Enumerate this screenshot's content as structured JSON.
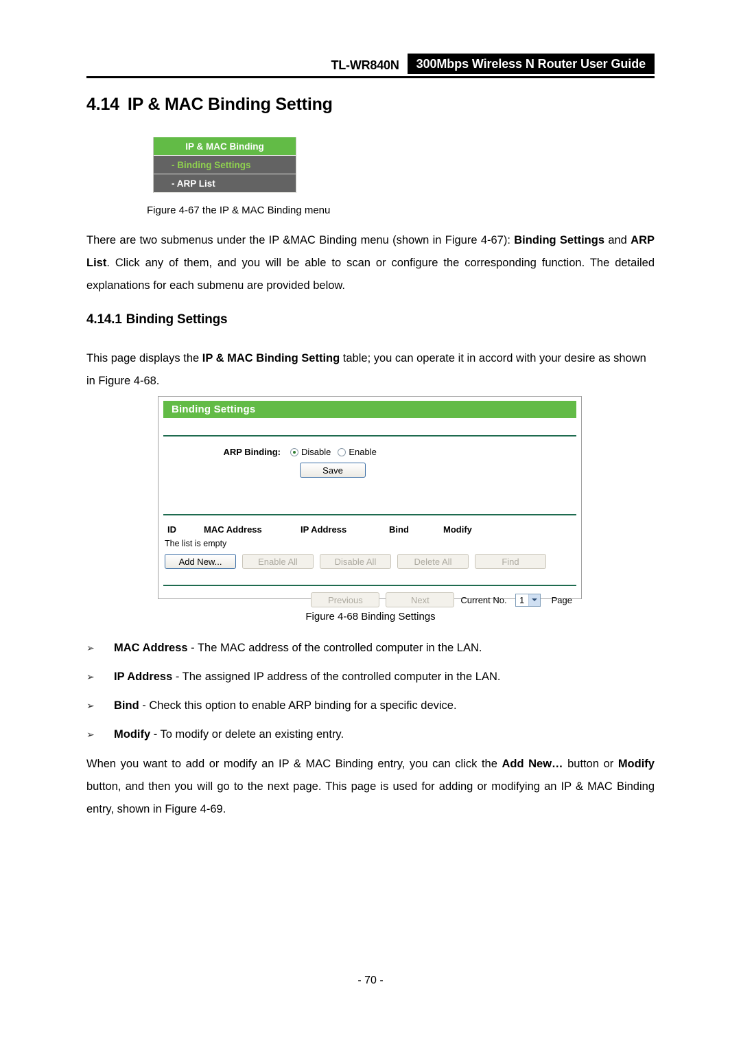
{
  "header": {
    "model": "TL-WR840N",
    "title": "300Mbps Wireless N Router User Guide"
  },
  "section": {
    "number": "4.14",
    "title": "IP & MAC Binding Setting"
  },
  "menu_figure": {
    "items": [
      {
        "label": "IP & MAC Binding",
        "state": "header"
      },
      {
        "label": "- Binding Settings",
        "state": "active"
      },
      {
        "label": "- ARP List",
        "state": "normal"
      }
    ],
    "caption": "Figure 4-67 the IP & MAC Binding menu"
  },
  "paragraph_1": {
    "part1": "There are two submenus under the IP &MAC Binding menu (shown in Figure 4-67): ",
    "bold1": "Binding Settings",
    "part2": " and ",
    "bold2": "ARP List",
    "part3": ". Click any of them, and you will be able to scan or configure the corresponding function. The detailed explanations for each submenu are provided below."
  },
  "subsection": {
    "number": "4.14.1",
    "title": "Binding Settings"
  },
  "paragraph_2": {
    "part1": "This page displays the ",
    "bold1": "IP & MAC Binding Setting",
    "part2": " table; you can operate it in accord with your desire as shown in Figure 4-68."
  },
  "panel": {
    "title": "Binding Settings",
    "arp_binding_label": "ARP Binding:",
    "radio_disable": "Disable",
    "radio_enable": "Enable",
    "selected_radio": "Disable",
    "save_label": "Save",
    "table_headers": [
      "ID",
      "MAC Address",
      "IP Address",
      "Bind",
      "Modify"
    ],
    "empty_message": "The list is empty",
    "action_buttons": [
      {
        "label": "Add New...",
        "enabled": true
      },
      {
        "label": "Enable All",
        "enabled": false
      },
      {
        "label": "Disable All",
        "enabled": false
      },
      {
        "label": "Delete All",
        "enabled": false
      },
      {
        "label": "Find",
        "enabled": false
      }
    ],
    "pagination": {
      "previous_label": "Previous",
      "next_label": "Next",
      "current_no_label": "Current No.",
      "current_page_value": "1",
      "page_label": "Page"
    },
    "colors": {
      "title_bar_green": "#62bb46",
      "divider_green": "#1e6b4f",
      "menu_gray": "#636363",
      "menu_active_text": "#8fd14f"
    }
  },
  "panel_caption": "Figure 4-68 Binding Settings",
  "bullets": [
    {
      "marker": "➢",
      "term": "MAC Address",
      "dash": " - ",
      "text": "The MAC address of the controlled computer in the LAN."
    },
    {
      "marker": "➢",
      "term": "IP Address",
      "dash": " - ",
      "text": "The assigned IP address of the controlled computer in the LAN."
    },
    {
      "marker": "➢",
      "term": "Bind",
      "dash": " - ",
      "text": "Check this option to enable ARP binding for a specific device."
    },
    {
      "marker": "➢",
      "term": "Modify",
      "dash": " - ",
      "text": "To modify or delete an existing entry."
    }
  ],
  "paragraph_3": {
    "part1": "When you want to add or modify an IP & MAC Binding entry, you can click the ",
    "bold1": "Add New…",
    "part2": " button or ",
    "bold2": "Modify",
    "part3": " button, and then you will go to the next page. This page is used for adding or modifying an IP & MAC Binding entry, shown in Figure 4-69."
  },
  "page_number": "- 70 -"
}
